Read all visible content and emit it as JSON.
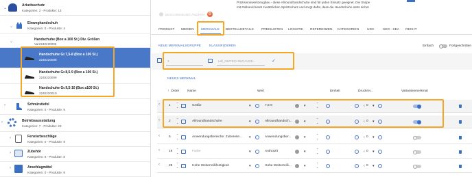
{
  "tree": [
    {
      "title": "Arbeitsschutz",
      "meta": "Kategorien: 2 - Produkte: 13"
    },
    {
      "title": "Einweghandschuh",
      "meta": "Kategorien: 0 - Produkte: 4"
    },
    {
      "title": "Handschuhe (Box a 100 St.) Div. Größen",
      "meta": "Var2240220006"
    },
    {
      "title": "Handschuhe Gr.7,5-8 (Box a 100 St.)",
      "meta": "2240220008"
    },
    {
      "title": "Handschuhe Gr.8,5-9 (Box a 100 St.)",
      "meta": "2240220009"
    },
    {
      "title": "Handschuhe Gr.9,5-10 (Box a100 St.)",
      "meta": "2240220010"
    },
    {
      "title": "Schnürstiefel",
      "meta": "Kategorien: 0 - Produkte: 9"
    },
    {
      "title": "Betriebsausstattung",
      "meta": "Kategorien: 7 - Produkte: 23"
    },
    {
      "title": "Fensterbeschläge",
      "meta": "Kategorien: 0 - Produkte: 9"
    },
    {
      "title": "Zubehör",
      "meta": "Kategorien: 0 - Produkte: 8"
    },
    {
      "title": "Anschlagmittel",
      "meta": "Kategorien: 0 - Produkte: 9"
    }
  ],
  "description": {
    "line1": "Präzisionswerkzeugbau - diese Allroundhandschuhe sind für jeden Einsatz geeignet. Die Stulpe",
    "line2": "mit Rollrand bietet zusätzlichen Spritzschutz und sorgt dafür, dass die Handschuhe stets sicher"
  },
  "top_label": "BESCHREIBUNG ÄNDERN",
  "tabs": [
    "PRODUKT",
    "MEDIEN",
    "MERKMALE",
    "BESTELLDETAILS",
    "PREISLISTEN",
    "LOGISTIK",
    "REFERENZEN",
    "KATEGORIEN",
    "UDX",
    "SEO - SEA",
    "RECHT"
  ],
  "active_tab": "MERKMALE",
  "actions": {
    "new_group": "NEUE MERKMALSGRUPPE",
    "classify": "KLASSIFIZIEREN",
    "simple": "Einfach",
    "advanced": "Fortgeschritten"
  },
  "group_form": {
    "order_value": "1",
    "name_placeholder": "udf_NMTECHNICALDE..."
  },
  "new_feature": "NEUES MERKMAL",
  "columns": {
    "order": "Order",
    "name": "Name",
    "value": "Wert",
    "unit": "Einheit",
    "print": "Druckrei...",
    "variant": "Variantenmerkmal"
  },
  "rows": [
    {
      "order": "1",
      "name": "Größe",
      "value": "7,5-8",
      "print": "0",
      "variant": true
    },
    {
      "order": "2",
      "name": "Allroundhandschuhe",
      "value": "Allroundhandsch...",
      "print": "0",
      "variant": true
    },
    {
      "order": "5",
      "name": "Anwendungsbereiche: Zubereite...",
      "value": "Anwendungsber...",
      "print": "0",
      "variant": false
    },
    {
      "order": "19",
      "name": "Farbe",
      "value": "Anthrazit",
      "print": "0",
      "variant": false
    },
    {
      "order": "28",
      "name": "Hohe Weiterreißfestigkeit",
      "value": "Hohe Weiterreiß...",
      "print": "0",
      "variant": false
    }
  ],
  "colors": {
    "accent": "#4a78c9",
    "highlight": "#f5a623",
    "selected_row": "#4a78c9"
  }
}
